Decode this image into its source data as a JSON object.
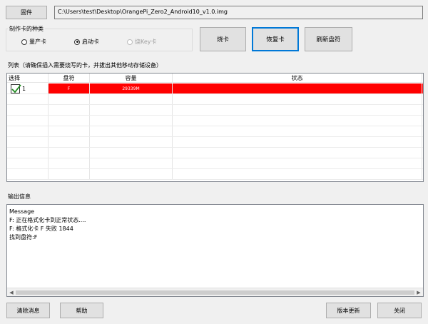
{
  "top": {
    "firmware_button": "固件",
    "image_path": "C:\\Users\\test\\Desktop\\OrangePi_Zero2_Android10_v1.0.img"
  },
  "card_type": {
    "legend": "制作卡的种类",
    "options": [
      {
        "label": "量产卡",
        "selected": false,
        "disabled": false
      },
      {
        "label": "启动卡",
        "selected": true,
        "disabled": false
      },
      {
        "label": "烧Key卡",
        "selected": false,
        "disabled": true
      }
    ]
  },
  "actions": {
    "burn": "烧卡",
    "restore": "恢复卡",
    "refresh": "刷新盘符"
  },
  "list": {
    "legend": "列表（请确保插入需要烧写的卡，并拔出其他移动存储设备）",
    "columns": [
      "选择",
      "盘符",
      "容量",
      "状态"
    ],
    "rows": [
      {
        "index": "1",
        "drive": "F",
        "capacity": "29339M",
        "status": "",
        "checked": true
      }
    ]
  },
  "output": {
    "legend": "输出信息",
    "lines": [
      "Message",
      "F: 正在格式化卡到正常状态....",
      "F: 格式化卡 F 失败 1844",
      "找到盘符:F"
    ]
  },
  "bottom": {
    "clear": "清除消息",
    "help": "帮助",
    "version": "版本更新",
    "close": "关闭"
  }
}
